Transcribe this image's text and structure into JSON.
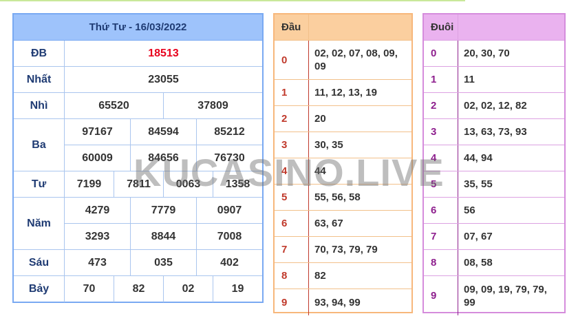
{
  "results": {
    "title": "Thứ Tư - 16/03/2022",
    "rows": [
      {
        "label": "ĐB",
        "lines": [
          [
            "18513"
          ]
        ]
      },
      {
        "label": "Nhất",
        "lines": [
          [
            "23055"
          ]
        ]
      },
      {
        "label": "Nhì",
        "lines": [
          [
            "65520",
            "37809"
          ]
        ]
      },
      {
        "label": "Ba",
        "lines": [
          [
            "97167",
            "84594",
            "85212"
          ],
          [
            "60009",
            "84656",
            "76730"
          ]
        ]
      },
      {
        "label": "Tư",
        "lines": [
          [
            "7199",
            "7811",
            "0063",
            "1358"
          ]
        ]
      },
      {
        "label": "Năm",
        "lines": [
          [
            "4279",
            "7779",
            "0907"
          ],
          [
            "3293",
            "8844",
            "7008"
          ]
        ]
      },
      {
        "label": "Sáu",
        "lines": [
          [
            "473",
            "035",
            "402"
          ]
        ]
      },
      {
        "label": "Bảy",
        "lines": [
          [
            "70",
            "82",
            "02",
            "19"
          ]
        ]
      }
    ]
  },
  "dau": {
    "header": "Đầu",
    "rows": [
      {
        "k": "0",
        "v": "02, 02, 07, 08, 09, 09"
      },
      {
        "k": "1",
        "v": "11, 12, 13, 19"
      },
      {
        "k": "2",
        "v": "20"
      },
      {
        "k": "3",
        "v": "30, 35"
      },
      {
        "k": "4",
        "v": "44"
      },
      {
        "k": "5",
        "v": "55, 56, 58"
      },
      {
        "k": "6",
        "v": "63, 67"
      },
      {
        "k": "7",
        "v": "70, 73, 79, 79"
      },
      {
        "k": "8",
        "v": "82"
      },
      {
        "k": "9",
        "v": "93, 94, 99"
      }
    ]
  },
  "duoi": {
    "header": "Đuôi",
    "rows": [
      {
        "k": "0",
        "v": "20, 30, 70"
      },
      {
        "k": "1",
        "v": "11"
      },
      {
        "k": "2",
        "v": "02, 02, 12, 82"
      },
      {
        "k": "3",
        "v": "13, 63, 73, 93"
      },
      {
        "k": "4",
        "v": "44, 94"
      },
      {
        "k": "5",
        "v": "35, 55"
      },
      {
        "k": "6",
        "v": "56"
      },
      {
        "k": "7",
        "v": "07, 67"
      },
      {
        "k": "8",
        "v": "08, 58"
      },
      {
        "k": "9",
        "v": "09, 09, 19, 79, 79, 99"
      }
    ]
  },
  "watermark": "KUCASINO.LIVE",
  "colors": {
    "special_prize": "#e8001c",
    "results_header": "#9ec3fb",
    "dau_header": "#fbcf9f",
    "duoi_header": "#eab2ef"
  }
}
